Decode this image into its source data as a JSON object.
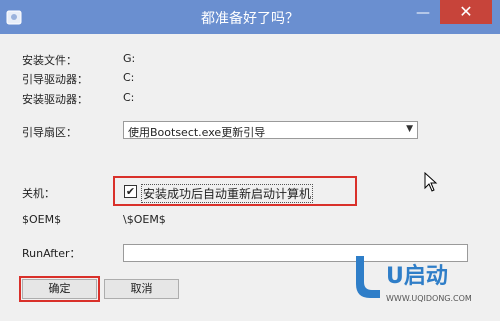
{
  "window": {
    "title": "都准备好了吗？",
    "minimize_glyph": "—",
    "close_glyph": "✕"
  },
  "fields": {
    "install_files_label": "安装文件：",
    "install_files_value": "G:",
    "boot_drive_label": "引导驱动器：",
    "boot_drive_value": "C:",
    "install_drive_label": "安装驱动器：",
    "install_drive_value": "C:",
    "boot_sector_label": "引导扇区：",
    "boot_sector_value": "使用Bootsect.exe更新引导",
    "shutdown_label": "关机：",
    "restart_checkbox_label": "安装成功后自动重新启动计算机",
    "restart_checked": true,
    "oem_label": "$OEM$",
    "oem_value": "\\$OEM$",
    "runafter_label": "RunAfter：",
    "runafter_value": ""
  },
  "buttons": {
    "ok_label": "确定",
    "cancel_label": "取消"
  },
  "watermark": {
    "text": "U启动",
    "url": "WWW.UQIDONG.COM"
  },
  "colors": {
    "titlebar": "#6a8fd0",
    "close": "#c7443a",
    "highlight_box": "#d9302a"
  }
}
